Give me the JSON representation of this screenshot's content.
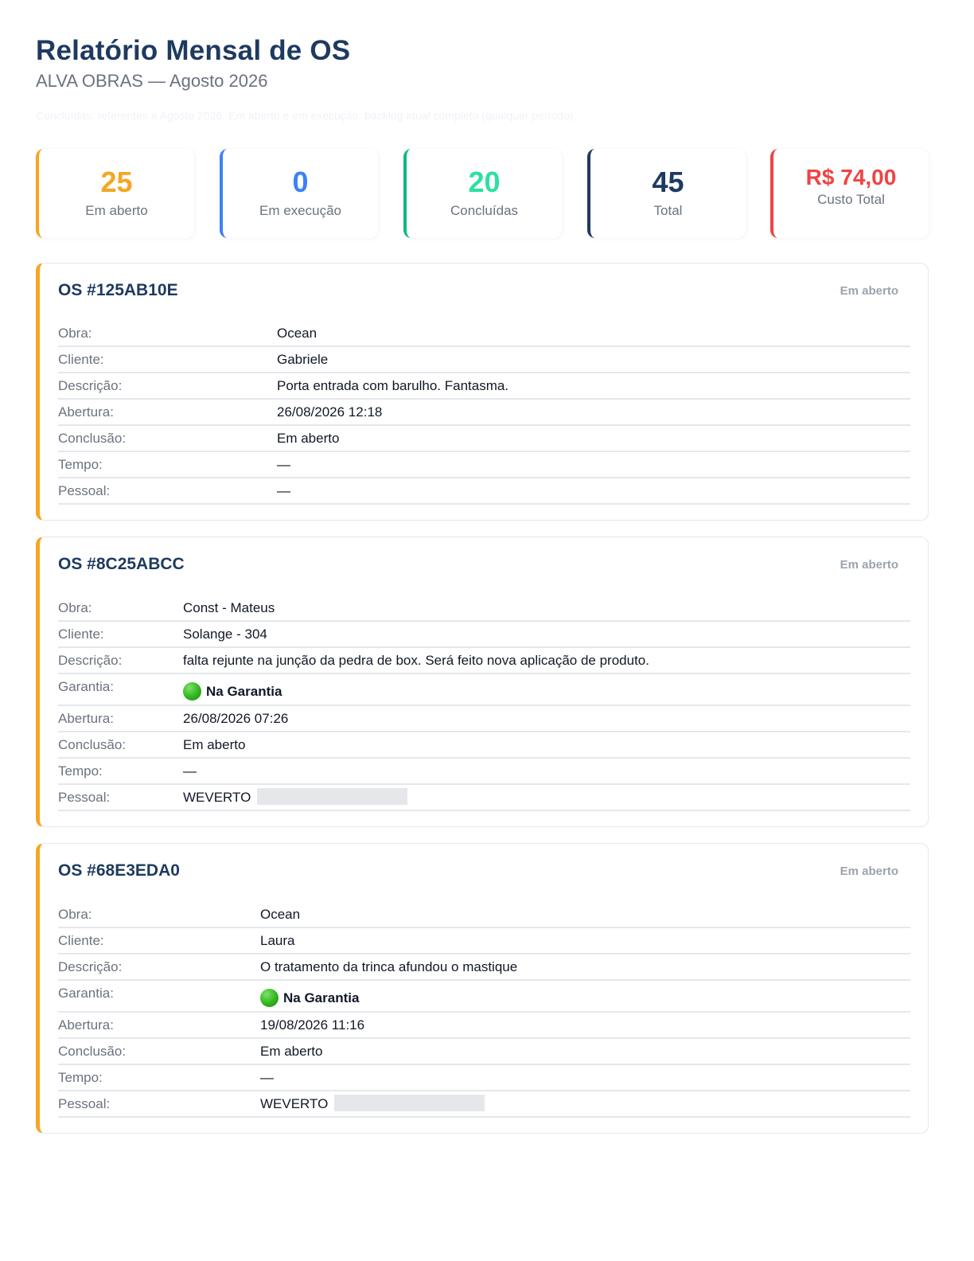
{
  "header": {
    "title": "Relatório Mensal de OS",
    "subtitle": "ALVA OBRAS — Agosto 2026",
    "note": "Concluídas: referentes a Agosto 2026. Em aberto e em execução: backlog atual completo (qualquer período)."
  },
  "stats": [
    {
      "value": "25",
      "label": "Em aberto",
      "color": "#f5a623"
    },
    {
      "value": "0",
      "label": "Em execução",
      "color": "#3b82f6"
    },
    {
      "value": "20",
      "label": "Concluídas",
      "color": "#2de0a0"
    },
    {
      "value": "45",
      "label": "Total",
      "color": "#1e3a5f"
    },
    {
      "value": "R$ 74,00",
      "label": "Custo Total",
      "color": "#ef4444"
    }
  ],
  "labels": {
    "obra": "Obra:",
    "cliente": "Cliente:",
    "descricao": "Descrição:",
    "garantia": "Garantia:",
    "abertura": "Abertura:",
    "conclusao": "Conclusão:",
    "tempo": "Tempo:",
    "pessoal": "Pessoal:"
  },
  "orders": [
    {
      "id": "OS #125AB10E",
      "status": "Em aberto",
      "obra": "Ocean",
      "cliente": "Gabriele",
      "descricao": "Porta entrada com barulho. Fantasma.",
      "abertura": "26/08/2026 12:18",
      "conclusao": "Em aberto",
      "tempo": "—",
      "pessoal": "—"
    },
    {
      "id": "OS #8C25ABCC",
      "status": "Em aberto",
      "obra": "Const - Mateus",
      "cliente": "Solange - 304",
      "descricao": "falta rejunte na junção da pedra de box. Será feito nova aplicação de produto.",
      "garantia": "Na Garantia",
      "abertura": "26/08/2026 07:26",
      "conclusao": "Em aberto",
      "tempo": "—",
      "pessoal": "WEVERTO"
    },
    {
      "id": "OS #68E3EDA0",
      "status": "Em aberto",
      "obra": "Ocean",
      "cliente": "Laura",
      "descricao": "O tratamento da trinca afundou o mastique",
      "garantia": "Na Garantia",
      "abertura": "19/08/2026 11:16",
      "conclusao": "Em aberto",
      "tempo": "—",
      "pessoal": "WEVERTO"
    }
  ]
}
